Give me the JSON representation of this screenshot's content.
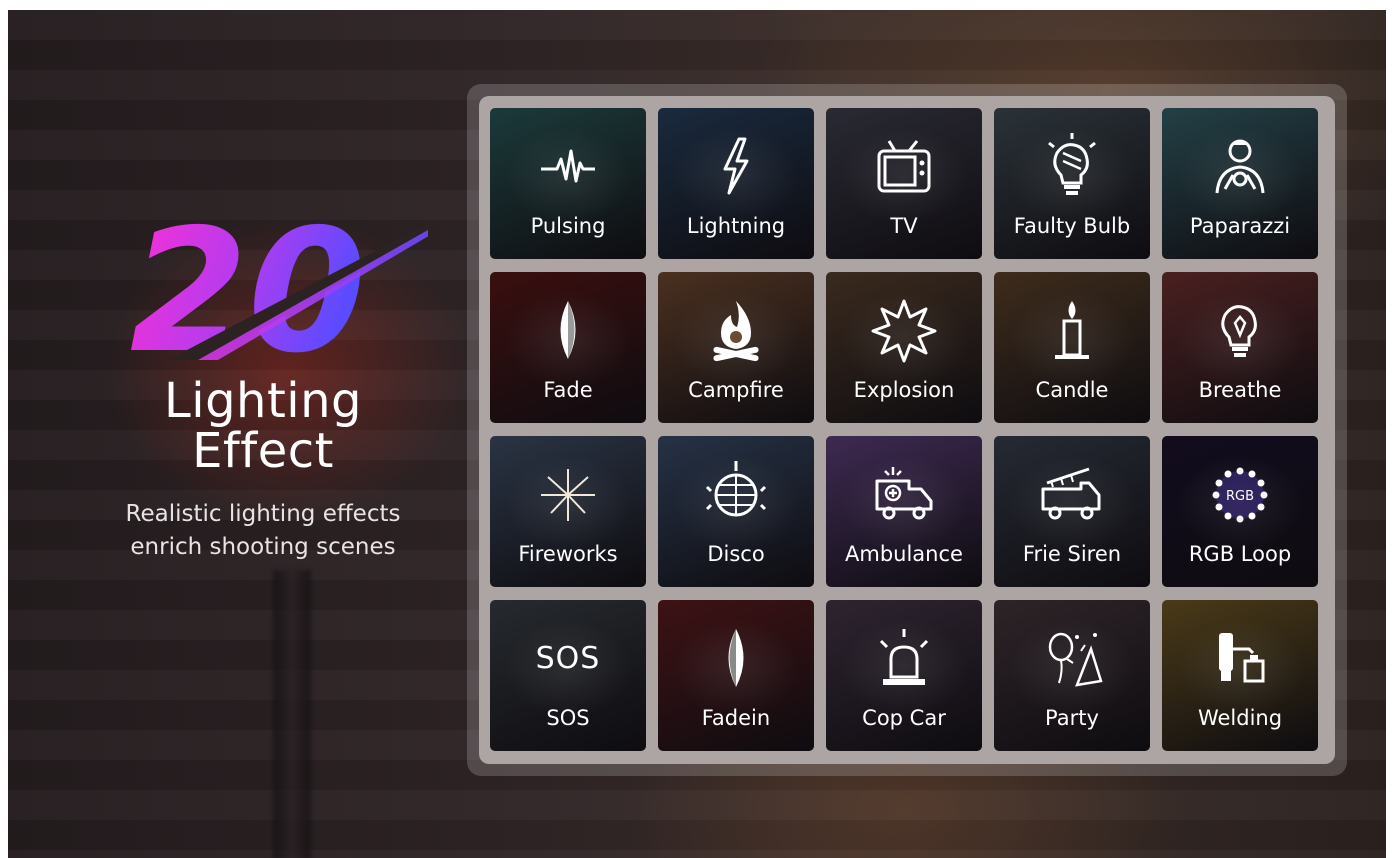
{
  "hero": {
    "number": "20",
    "title_line1": "Lighting",
    "title_line2": "Effect",
    "subtitle_line1": "Realistic lighting effects",
    "subtitle_line2": "enrich shooting scenes"
  },
  "effects": [
    {
      "label": "Pulsing",
      "icon": "pulse-icon",
      "bg": "#1c3a3a"
    },
    {
      "label": "Lightning",
      "icon": "lightning-icon",
      "bg": "#1a2a3e"
    },
    {
      "label": "TV",
      "icon": "tv-icon",
      "bg": "#2a2a34"
    },
    {
      "label": "Faulty Bulb",
      "icon": "faulty-bulb-icon",
      "bg": "#2a3238"
    },
    {
      "label": "Paparazzi",
      "icon": "paparazzi-icon",
      "bg": "#234046"
    },
    {
      "label": "Fade",
      "icon": "fade-icon",
      "bg": "#3a0f0f"
    },
    {
      "label": "Campfire",
      "icon": "campfire-icon",
      "bg": "#4a3020"
    },
    {
      "label": "Explosion",
      "icon": "explosion-icon",
      "bg": "#3a2a1e"
    },
    {
      "label": "Candle",
      "icon": "candle-icon",
      "bg": "#3e2c1c"
    },
    {
      "label": "Breathe",
      "icon": "breathe-bulb-icon",
      "bg": "#4a2020"
    },
    {
      "label": "Fireworks",
      "icon": "fireworks-icon",
      "bg": "#2a3444"
    },
    {
      "label": "Disco",
      "icon": "disco-ball-icon",
      "bg": "#263246"
    },
    {
      "label": "Ambulance",
      "icon": "ambulance-icon",
      "bg": "#3e2a52"
    },
    {
      "label": "Frie Siren",
      "icon": "fire-truck-icon",
      "bg": "#262a34"
    },
    {
      "label": "RGB Loop",
      "icon": "rgb-loop-icon",
      "bg": "#120c1e"
    },
    {
      "label": "SOS",
      "icon": "sos-icon",
      "bg": "#262a2e",
      "icon_text": "SOS"
    },
    {
      "label": "Fadein",
      "icon": "fadein-icon",
      "bg": "#3e1214"
    },
    {
      "label": "Cop Car",
      "icon": "siren-icon",
      "bg": "#2e2430"
    },
    {
      "label": "Party",
      "icon": "party-icon",
      "bg": "#2e2428"
    },
    {
      "label": "Welding",
      "icon": "welding-icon",
      "bg": "#4a3a18"
    }
  ],
  "icon_rgb_text": "RGB",
  "colors": {
    "number_gradient_start": "#ff2fd2",
    "number_gradient_end": "#5a4bff",
    "panel_border": "#aca5a3"
  }
}
